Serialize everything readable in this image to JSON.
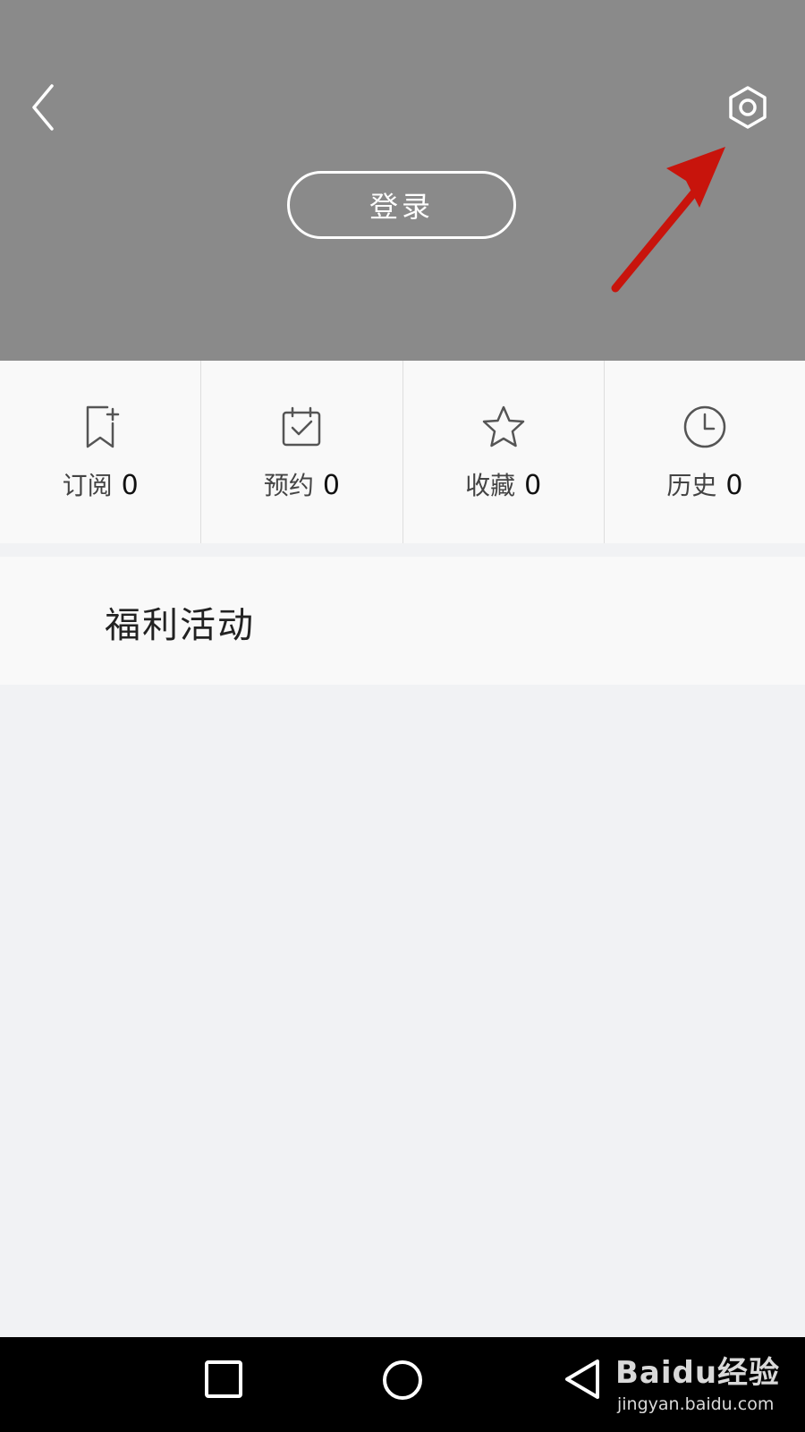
{
  "header": {
    "back_icon": "chevron-left-icon",
    "settings_icon": "gear-icon",
    "login_label": "登录",
    "background_color": "#8a8a8a",
    "annotation_arrow_color": "#c8140c"
  },
  "stats": [
    {
      "label": "订阅",
      "count": "0",
      "icon": "bookmark-plus-icon"
    },
    {
      "label": "预约",
      "count": "0",
      "icon": "calendar-check-icon"
    },
    {
      "label": "收藏",
      "count": "0",
      "icon": "star-icon"
    },
    {
      "label": "历史",
      "count": "0",
      "icon": "clock-icon"
    }
  ],
  "section": {
    "title": "福利活动"
  },
  "navbar": {
    "recents_icon": "square-icon",
    "home_icon": "circle-icon",
    "back_icon": "triangle-back-icon"
  },
  "watermark": {
    "brand": "Baidu经验",
    "url": "jingyan.baidu.com"
  }
}
